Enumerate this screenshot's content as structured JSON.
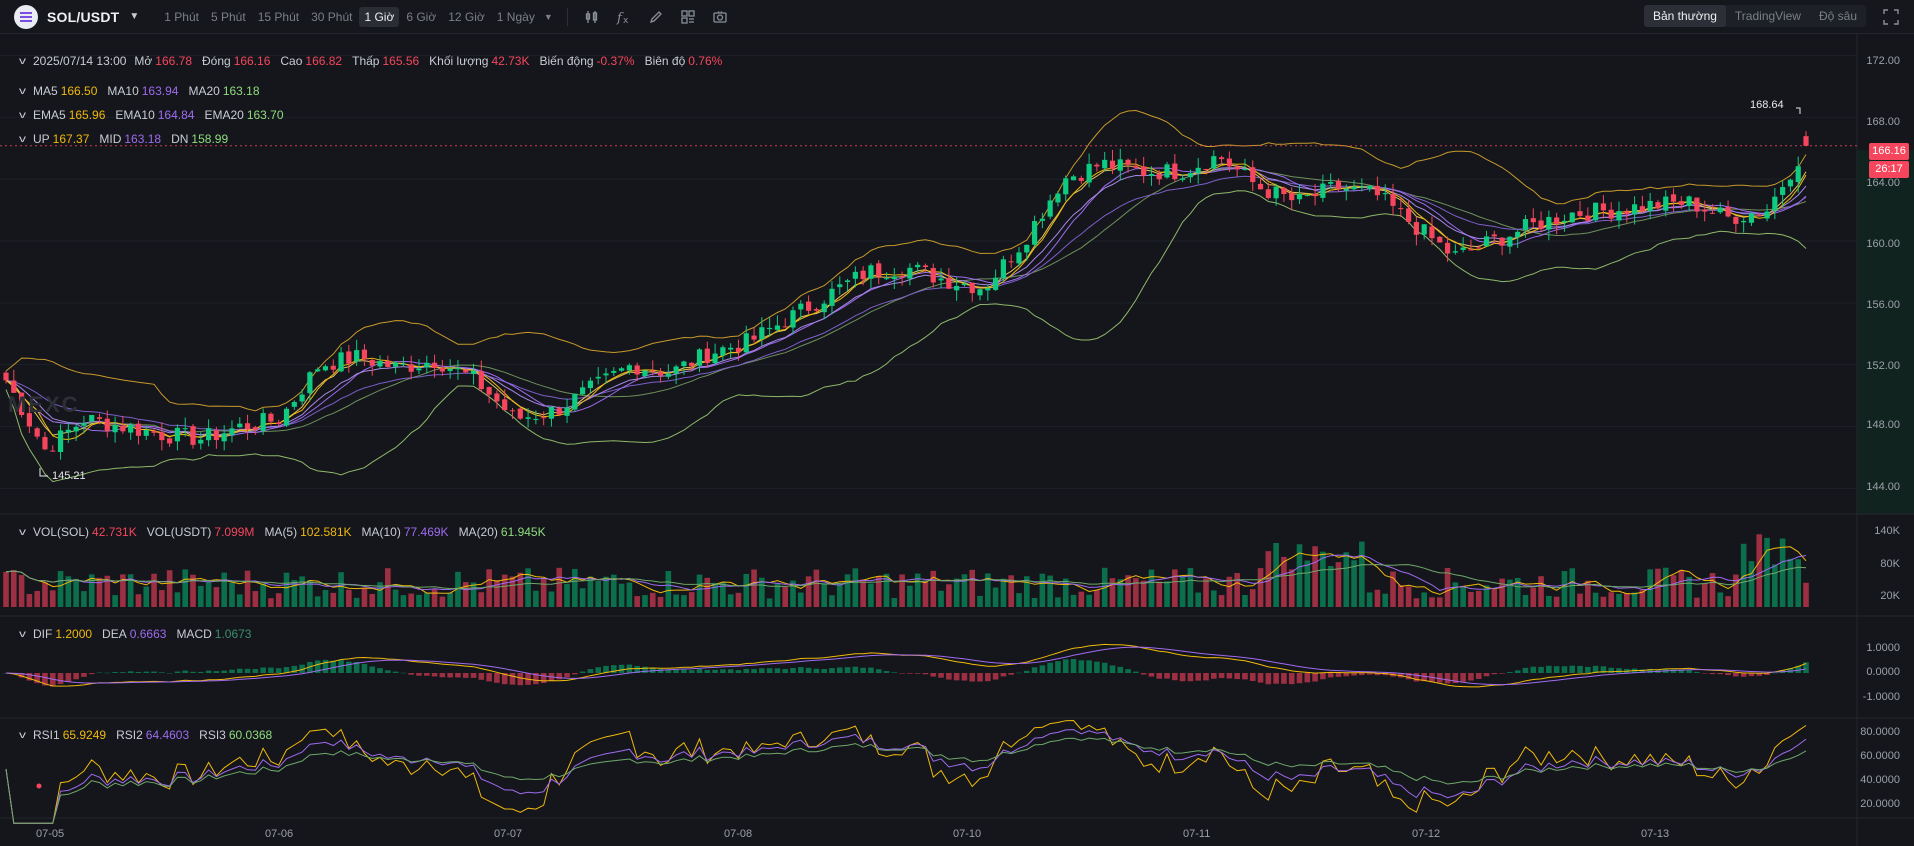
{
  "toolbar": {
    "pair": "SOL/USDT",
    "intervals": [
      "1 Phút",
      "5 Phút",
      "15 Phút",
      "30 Phút",
      "1 Giờ",
      "6 Giờ",
      "12 Giờ",
      "1 Ngày"
    ],
    "active_interval": "1 Giờ",
    "views": [
      "Bản thường",
      "TradingView",
      "Độ sâu"
    ],
    "active_view": "Bản thường",
    "tools": [
      "indicator-icon",
      "formula-icon",
      "pencil-icon",
      "layout-icon",
      "camera-icon"
    ]
  },
  "ohlc": {
    "date": "2025/07/14 13:00",
    "open_label": "Mở",
    "open": "166.78",
    "close_label": "Đóng",
    "close": "166.16",
    "high_label": "Cao",
    "high": "166.82",
    "low_label": "Thấp",
    "low": "165.56",
    "volume_label": "Khối lượng",
    "volume": "42.73K",
    "change_label": "Biến động",
    "change": "-0.37%",
    "amplitude_label": "Biên độ",
    "amplitude": "0.76%"
  },
  "ma": {
    "ma5_label": "MA5",
    "ma5": "166.50",
    "ma10_label": "MA10",
    "ma10": "163.94",
    "ma20_label": "MA20",
    "ma20": "163.18"
  },
  "ema": {
    "ema5_label": "EMA5",
    "ema5": "165.96",
    "ema10_label": "EMA10",
    "ema10": "164.84",
    "ema20_label": "EMA20",
    "ema20": "163.70"
  },
  "boll": {
    "up_label": "UP",
    "up": "167.37",
    "mid_label": "MID",
    "mid": "163.18",
    "dn_label": "DN",
    "dn": "158.99"
  },
  "vol": {
    "sol_label": "VOL(SOL)",
    "sol": "42.731K",
    "usdt_label": "VOL(USDT)",
    "usdt": "7.099M",
    "ma5_label": "MA(5)",
    "ma5": "102.581K",
    "ma10_label": "MA(10)",
    "ma10": "77.469K",
    "ma20_label": "MA(20)",
    "ma20": "61.945K"
  },
  "macd": {
    "dif_label": "DIF",
    "dif": "1.2000",
    "dea_label": "DEA",
    "dea": "0.6663",
    "macd_label": "MACD",
    "macd": "1.0673"
  },
  "rsi": {
    "rsi1_label": "RSI1",
    "rsi1": "65.9249",
    "rsi2_label": "RSI2",
    "rsi2": "64.4603",
    "rsi3_label": "RSI3",
    "rsi3": "60.0368"
  },
  "axes": {
    "price_ticks": [
      "172.00",
      "168.00",
      "164.00",
      "160.00",
      "156.00",
      "152.00",
      "148.00",
      "144.00"
    ],
    "vol_ticks": [
      "140K",
      "80K",
      "20K"
    ],
    "macd_ticks": [
      "1.0000",
      "0.0000",
      "-1.0000"
    ],
    "rsi_ticks": [
      "80.0000",
      "60.0000",
      "40.0000",
      "20.0000"
    ],
    "dates": [
      "07-05",
      "07-06",
      "07-07",
      "07-08",
      "07-10",
      "07-11",
      "07-12",
      "07-13"
    ]
  },
  "current_price": "166.16",
  "countdown": "26:17",
  "high_marker": "168.64",
  "low_marker": "145.21",
  "watermark": "MEXC",
  "colors": {
    "up": "#0ecb81",
    "down": "#f6465d",
    "yellow": "#f0b90b",
    "purple": "#9f6bf0",
    "green": "#8fdc7d"
  },
  "chart_data": {
    "type": "candlestick",
    "interval": "1 Giờ",
    "x": [
      "07-05",
      "07-06",
      "07-07",
      "07-08",
      "07-10",
      "07-11",
      "07-12",
      "07-13"
    ],
    "close_path": [
      151.0,
      146.5,
      148.5,
      148.0,
      147.5,
      147.2,
      148.0,
      148.5,
      152.0,
      152.5,
      151.8,
      152.3,
      151.0,
      148.5,
      149.0,
      150.5,
      152.0,
      151.5,
      152.8,
      153.5,
      155.0,
      156.5,
      158.0,
      158.3,
      157.5,
      157.0,
      160.0,
      164.0,
      165.0,
      164.5,
      164.5,
      165.5,
      163.5,
      162.5,
      163.5,
      163.0,
      161.0,
      159.0,
      160.0,
      161.0,
      161.8,
      162.0,
      162.3,
      162.5,
      161.5,
      162.0,
      166.2
    ]
  }
}
